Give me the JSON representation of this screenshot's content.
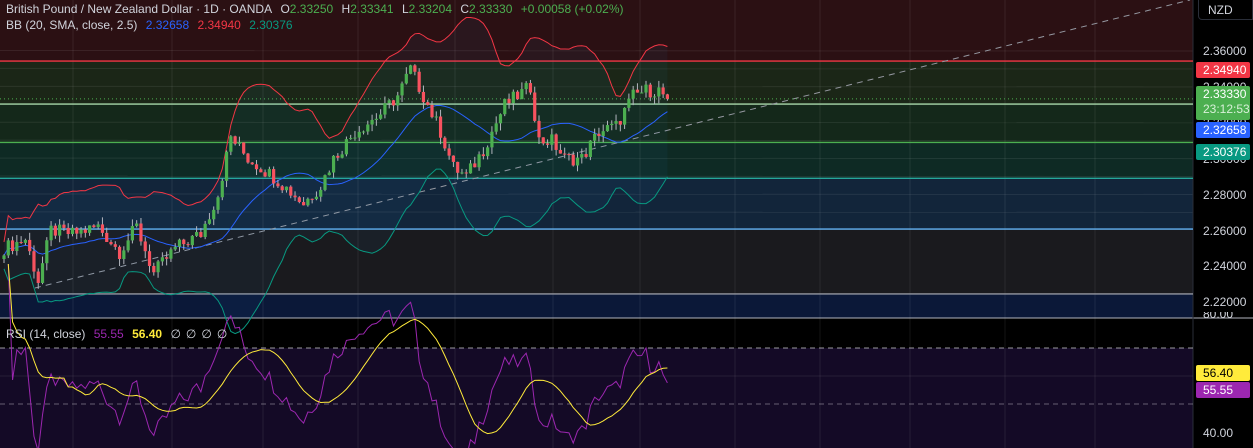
{
  "header": {
    "title": "British Pound / New Zealand Dollar · 1D · OANDA",
    "open_label": "O",
    "open": "2.33250",
    "high_label": "H",
    "high": "2.33341",
    "low_label": "L",
    "low": "2.33204",
    "close_label": "C",
    "close": "2.33330",
    "change": "+0.00058 (+0.02%)"
  },
  "bb": {
    "label": "BB (20, SMA, close, 2.5)",
    "basis": "2.32658",
    "upper": "2.34940",
    "lower": "2.30376"
  },
  "rsi": {
    "label": "RSI (14, close)",
    "value": "55.55",
    "ma": "56.40",
    "extras": [
      "∅",
      "∅",
      "∅",
      "∅"
    ],
    "axis": [
      "80.00",
      "40.00"
    ]
  },
  "axis": {
    "currency": "NZD",
    "ticks": [
      "2.36000",
      "2.34000",
      "2.32000",
      "2.30000",
      "2.28000",
      "2.26000",
      "2.24000",
      "2.22000"
    ],
    "price_tag": "2.33330",
    "countdown": "23:12:53",
    "upper_tag": "2.34940",
    "basis_tag": "2.32658",
    "lower_tag": "2.30376"
  },
  "colors": {
    "up": "#4caf50",
    "down": "#f7525f",
    "upper": "#f23645",
    "basis": "#2962ff",
    "lower": "#089981",
    "rsi": "#9c27b0",
    "rsi_ma": "#ffeb3b"
  },
  "chart_data": {
    "type": "candlestick",
    "ylim": [
      2.215,
      2.365
    ],
    "levels": [
      2.3544,
      2.3304,
      2.309,
      2.289,
      2.2607,
      2.2245
    ],
    "price_path": [
      [
        0,
        2.25
      ],
      [
        5,
        2.255
      ],
      [
        8,
        2.232
      ],
      [
        11,
        2.26
      ],
      [
        16,
        2.258
      ],
      [
        22,
        2.262
      ],
      [
        27,
        2.248
      ],
      [
        31,
        2.262
      ],
      [
        35,
        2.236
      ],
      [
        40,
        2.25
      ],
      [
        46,
        2.258
      ],
      [
        50,
        2.28
      ],
      [
        53,
        2.312
      ],
      [
        57,
        2.3
      ],
      [
        63,
        2.29
      ],
      [
        70,
        2.275
      ],
      [
        74,
        2.285
      ],
      [
        77,
        2.3
      ],
      [
        82,
        2.315
      ],
      [
        88,
        2.325
      ],
      [
        92,
        2.335
      ],
      [
        95,
        2.35
      ],
      [
        98,
        2.335
      ],
      [
        102,
        2.315
      ],
      [
        105,
        2.295
      ],
      [
        108,
        2.29
      ],
      [
        112,
        2.305
      ],
      [
        117,
        2.33
      ],
      [
        120,
        2.335
      ],
      [
        123,
        2.34
      ],
      [
        125,
        2.31
      ],
      [
        128,
        2.31
      ],
      [
        131,
        2.3
      ],
      [
        135,
        2.3
      ],
      [
        139,
        2.315
      ],
      [
        143,
        2.318
      ],
      [
        147,
        2.335
      ],
      [
        150,
        2.338
      ],
      [
        153,
        2.338
      ],
      [
        155,
        2.3333
      ]
    ]
  }
}
